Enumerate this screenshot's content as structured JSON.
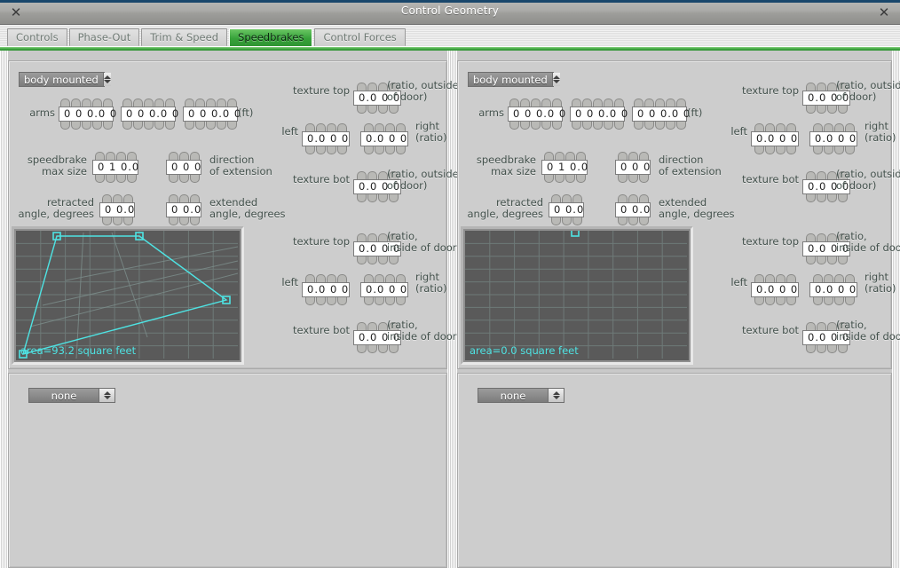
{
  "window": {
    "title": "Control Geometry",
    "close_icon": "close-icon",
    "close_glyph": "✕"
  },
  "tabs": [
    {
      "label": "Controls",
      "active": false
    },
    {
      "label": "Phase-Out",
      "active": false
    },
    {
      "label": "Trim & Speed",
      "active": false
    },
    {
      "label": "Speedbrakes",
      "active": true
    },
    {
      "label": "Control Forces",
      "active": false
    }
  ],
  "colors": {
    "accent_green": "#2f9433",
    "cyan": "#4ee3e3",
    "panel": "#cdcdcd",
    "canvas": "#5a5a5a",
    "titlebar_top": "#19476b"
  },
  "panels": [
    {
      "id": "speedbrake-1",
      "mount": {
        "value": "body mounted"
      },
      "arms": {
        "label": "arms",
        "unit": "(ft)",
        "values": [
          "0 0 0.0 0",
          "0 0 0.0 0",
          "0 0 0.0 0"
        ],
        "digits": 5
      },
      "max_size": {
        "label": "speedbrake\nmax size",
        "value": "0 1 0.0",
        "digits": 4
      },
      "direction": {
        "label": "direction\nof extension",
        "value": "0 0 0",
        "digits": 3
      },
      "retracted": {
        "label": "retracted\nangle, degrees",
        "value": "0 0.0",
        "digits": 3
      },
      "extended": {
        "label": "extended\nangle, degrees",
        "value": "0 0.0",
        "digits": 3
      },
      "textures": [
        {
          "label": "texture top",
          "note": "(ratio, outside\nof door)",
          "value": "0.0 0 0",
          "digits": 4
        },
        {
          "label": "left",
          "label2": "right\n(ratio)",
          "value": "0.0 0 0",
          "value2": "0.0 0 0",
          "digits": 4
        },
        {
          "label": "texture bot",
          "note": "(ratio, outside\nof door)",
          "value": "0.0 0 0",
          "digits": 4
        },
        {
          "label": "texture top",
          "note": "(ratio,\ninside of door)",
          "value": "0.0 0 0",
          "digits": 4
        },
        {
          "label": "left",
          "label2": "right\n(ratio)",
          "value": "0.0 0 0",
          "value2": "0.0 0 0",
          "digits": 4
        },
        {
          "label": "texture bot",
          "note": "(ratio,\ninside of door)",
          "value": "0.0 0 0",
          "digits": 4
        }
      ],
      "canvas": {
        "area_text": "area=93.2 square feet",
        "has_shape": true,
        "handles": [
          [
            46,
            6
          ],
          [
            139,
            6
          ],
          [
            237,
            78
          ],
          [
            8,
            139
          ]
        ]
      }
    },
    {
      "id": "speedbrake-2",
      "mount": {
        "value": "body mounted"
      },
      "arms": {
        "label": "arms",
        "unit": "(ft)",
        "values": [
          "0 0 0.0 0",
          "0 0 0.0 0",
          "0 0 0.0 0"
        ],
        "digits": 5
      },
      "max_size": {
        "label": "speedbrake\nmax size",
        "value": "0 1 0.0",
        "digits": 4
      },
      "direction": {
        "label": "direction\nof extension",
        "value": "0 0 0",
        "digits": 3
      },
      "retracted": {
        "label": "retracted\nangle, degrees",
        "value": "0 0.0",
        "digits": 3
      },
      "extended": {
        "label": "extended\nangle, degrees",
        "value": "0 0.0",
        "digits": 3
      },
      "textures": [
        {
          "label": "texture top",
          "note": "(ratio, outside\nof door)",
          "value": "0.0 0 0",
          "digits": 4
        },
        {
          "label": "left",
          "label2": "right\n(ratio)",
          "value": "0.0 0 0",
          "value2": "0.0 0 0",
          "digits": 4
        },
        {
          "label": "texture bot",
          "note": "(ratio, outside\nof door)",
          "value": "0.0 0 0",
          "digits": 4
        },
        {
          "label": "texture top",
          "note": "(ratio,\ninside of door)",
          "value": "0.0 0 0",
          "digits": 4
        },
        {
          "label": "left",
          "label2": "right\n(ratio)",
          "value": "0.0 0 0",
          "value2": "0.0 0 0",
          "digits": 4
        },
        {
          "label": "texture bot",
          "note": "(ratio,\ninside of door)",
          "value": "0.0 0 0",
          "digits": 4
        }
      ],
      "canvas": {
        "area_text": "area=0.0 square feet",
        "has_shape": false,
        "handles": [
          [
            124,
            2
          ]
        ]
      }
    }
  ],
  "bottom_panels": [
    {
      "id": "bottom-1",
      "select": {
        "value": "none"
      }
    },
    {
      "id": "bottom-2",
      "select": {
        "value": "none"
      }
    }
  ]
}
